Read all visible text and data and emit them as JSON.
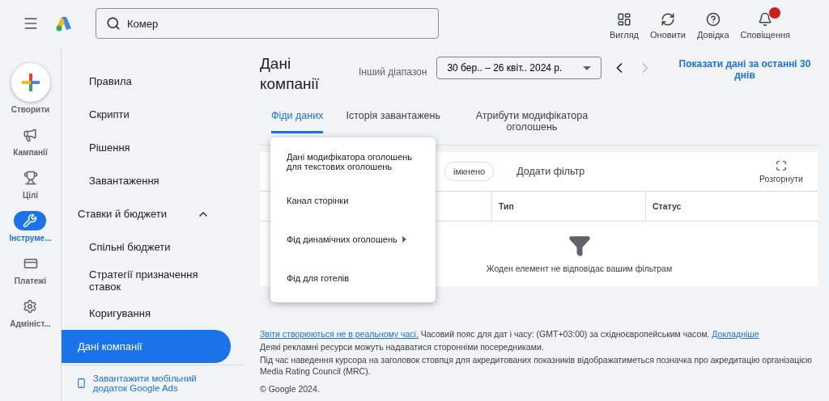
{
  "header": {
    "search": {
      "value": "Комер"
    },
    "actions": [
      {
        "kind": "view",
        "label": "Вигляд",
        "alert": false
      },
      {
        "kind": "refresh",
        "label": "Оновити",
        "alert": false
      },
      {
        "kind": "help",
        "label": "Довідка",
        "alert": false
      },
      {
        "kind": "bell",
        "label": "Сповіщення",
        "alert": true
      }
    ]
  },
  "rail": {
    "create": "Створити",
    "items": [
      {
        "kind": "campaign",
        "label": "Кампанії",
        "selected": false
      },
      {
        "kind": "goal",
        "label": "Цілі",
        "selected": false
      },
      {
        "kind": "tools",
        "label": "Інструме...",
        "selected": true
      },
      {
        "kind": "billing",
        "label": "Платежі",
        "selected": false
      },
      {
        "kind": "admin",
        "label": "Адмініст...",
        "selected": false
      }
    ]
  },
  "nav": {
    "items": [
      {
        "kind": "item",
        "label": "Правила",
        "selected": false
      },
      {
        "kind": "item",
        "label": "Скрипти",
        "selected": false
      },
      {
        "kind": "item",
        "label": "Рішення",
        "selected": false
      },
      {
        "kind": "item",
        "label": "Завантаження",
        "selected": false
      },
      {
        "kind": "section",
        "label": "Ставки й бюджети",
        "expanded": true
      },
      {
        "kind": "item",
        "label": "Спільні бюджети",
        "selected": false
      },
      {
        "kind": "item",
        "label": "Стратегії призначення ставок",
        "selected": false
      },
      {
        "kind": "item",
        "label": "Коригування",
        "selected": false
      },
      {
        "kind": "section-item",
        "label": "Дані компанії",
        "selected": true
      }
    ],
    "app_link": "Завантажити мобільний додаток Google Ads"
  },
  "page": {
    "title": "Дані компанії",
    "range_label": "Інший діапазон",
    "range": "30 бер.. – 26 квіт.. 2024 р.",
    "last30": "Показати дані за останні 30 днів",
    "tabs": [
      {
        "label": "Фіди даних",
        "selected": true
      },
      {
        "label": "Історія завантажень",
        "selected": false
      },
      {
        "label": "Атрибути модифікатора оголошень",
        "selected": false
      }
    ],
    "filter_chip": "імкнено",
    "add_filter": "Додати фільтр",
    "expand": "Розгорнути",
    "columns": [
      "Тип",
      "Статус"
    ],
    "empty": "Жоден елемент не відповідає вашим фільтрам",
    "menu": [
      {
        "label": "Дані модифікатора оголошень для текстових оголошень",
        "submenu": false
      },
      {
        "label": "Канал сторінки",
        "submenu": false
      },
      {
        "label": "Фід динамічних оголошень",
        "submenu": true
      },
      {
        "label": "Фід для готелів",
        "submenu": false
      }
    ]
  },
  "footer": {
    "link1": "Звіти створюються не в реальному часі.",
    "tz": "Часовий пояс для дат і часу: (GMT+03:00) за східноєвропейським часом.",
    "link2": "Докладніше",
    "lines": [
      "Деякі рекламні ресурси можуть надаватися сторонніми посередниками.",
      "Під час наведення курсора на заголовок стовпця для акредитованих показників відображатиметься позначка про акредитацію організацією Media Rating Council (MRC)."
    ],
    "copyright": "© Google 2024."
  }
}
